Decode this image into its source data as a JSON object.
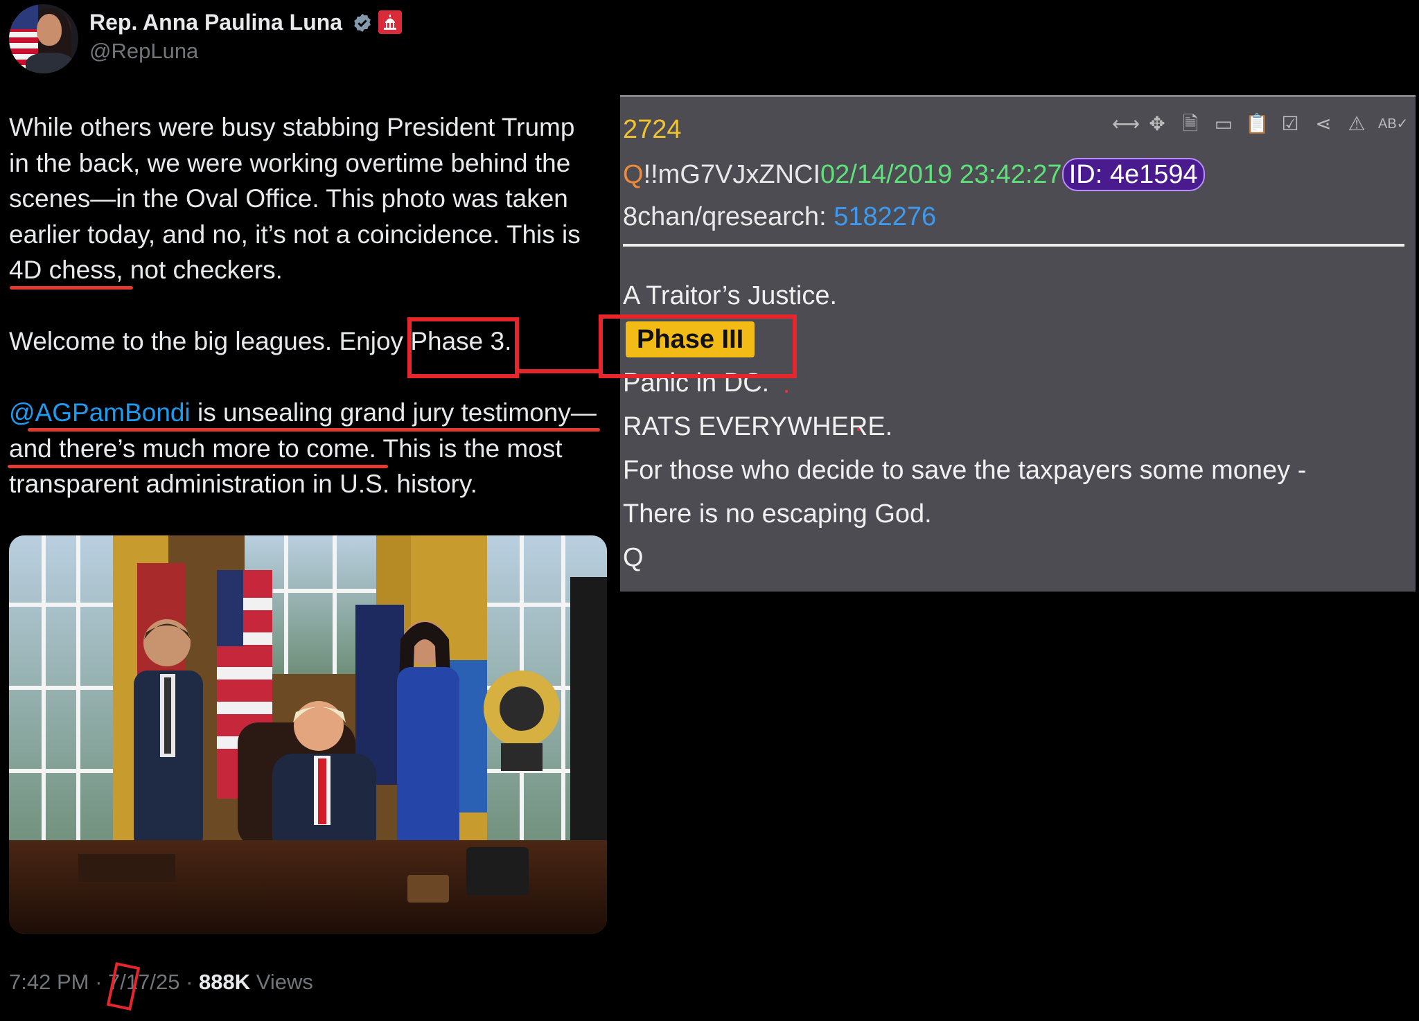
{
  "tweet": {
    "author_name": "Rep. Anna Paulina Luna",
    "handle": "@RepLuna",
    "body": {
      "line1": "While others were busy stabbing President Trump",
      "line2": "in the back, we were working overtime behind the",
      "line3": "scenes—in the Oval Office. This photo was taken",
      "line4": "earlier today, and no, it’s not a coincidence. This is",
      "line5_marked": "4D chess,",
      "line5_rest": " not checkers.",
      "line6_start": "Welcome to the big leagues. Enjoy ",
      "line6_marked": "Phase 3",
      "line6_end": ".",
      "mention": "@AGPamBondi",
      "line7_rest": " is unsealing grand jury testimony—",
      "line8_marked": "and there’s much more to come.",
      "line8_rest": " This is the most",
      "line9": "transparent administration in U.S. history."
    },
    "meta": {
      "time": "7:42 PM",
      "sep1": " · ",
      "date_month": "7/",
      "date_day": "17",
      "date_year": "/25",
      "sep2": " · ",
      "views_count": "888K",
      "views_label": " Views"
    },
    "icons": {
      "verified": "verified-badge-icon",
      "government": "capitol-government-badge-icon"
    }
  },
  "post": {
    "number": "2724",
    "trip_q": "Q",
    "trip_rest": "!!mG7VJxZNCI",
    "datetime": "02/14/2019 23:42:27",
    "id_label": "ID: 4e1594",
    "board": "8chan/qresearch: ",
    "board_link": "5182276",
    "body": {
      "line1": "A Traitor’s Justice.",
      "highlight": "Phase III",
      "line3": "Panic in DC.",
      "line4": "RATS EVERYWHERE.",
      "line5": "For those who decide to save the taxpayers some money -",
      "line6": "There is no escaping God.",
      "line7": "Q"
    },
    "tools": [
      "expand-arrows-icon",
      "move-icon",
      "file-icon",
      "vr-glasses-icon",
      "clipboard-icon",
      "clipboard-check-icon",
      "share-icon",
      "warning-circle-icon",
      "spellcheck-icon"
    ]
  },
  "colors": {
    "annotation_red": "#e5262d",
    "mention_blue": "#1d9bf0",
    "post_number_yellow": "#f0c330",
    "post_date_green": "#5ee07a",
    "post_id_purple": "#4a1b8e",
    "post_link_blue": "#3d9af0",
    "phase_highlight": "#f3bb16"
  }
}
